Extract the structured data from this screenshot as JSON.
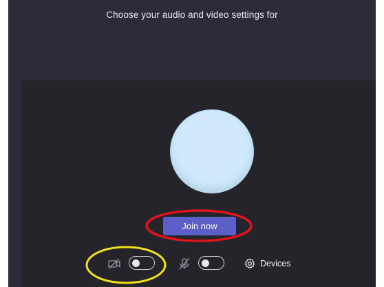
{
  "header": {
    "title": "Choose your audio and video settings for"
  },
  "preview": {
    "avatar_color": "#cfe9fb",
    "join_label": "Join now"
  },
  "controls": {
    "camera_icon": "camera-off-icon",
    "camera_toggle_on": false,
    "mic_icon": "mic-off-icon",
    "mic_toggle_on": false,
    "devices_icon": "gear-icon",
    "devices_label": "Devices"
  },
  "annotations": {
    "join_highlight_color": "#e0141c",
    "controls_highlight_color": "#f2e21a"
  },
  "colors": {
    "accent": "#5b5fc7",
    "background": "#2b2b39",
    "preview_background": "#24242a"
  }
}
